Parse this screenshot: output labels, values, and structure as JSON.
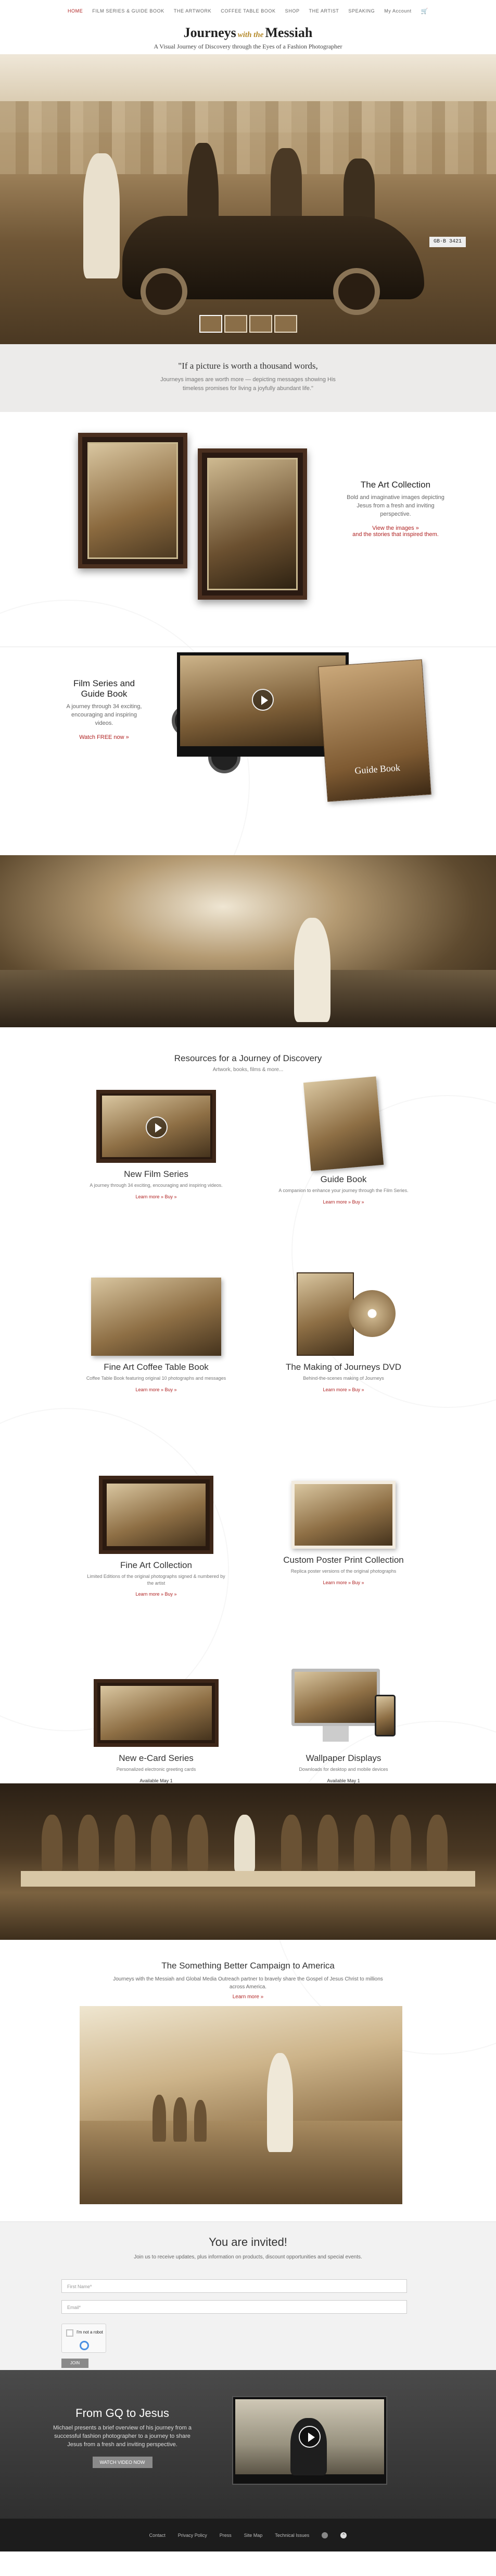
{
  "nav": {
    "items": [
      "HOME",
      "FILM SERIES & GUIDE BOOK",
      "THE ARTWORK",
      "COFFEE TABLE BOOK",
      "SHOP",
      "THE ARTIST",
      "SPEAKING",
      "My Account"
    ],
    "active_index": 0
  },
  "logo": {
    "title_left": "Journeys",
    "title_mid": "with the",
    "title_right": "Messiah",
    "subtitle": "A Visual Journey of Discovery through the Eyes of a Fashion Photographer"
  },
  "hero": {
    "plate": "GB·B 3421",
    "slide_count": 4,
    "active_slide": 1
  },
  "quote": {
    "main": "\"If a picture is worth a thousand words,",
    "text": "Journeys images are worth more — depicting messages showing His timeless promises for living a joyfully abundant life.\""
  },
  "art_collection": {
    "title": "The Art Collection",
    "body": "Bold and imaginative images depicting Jesus from a fresh and inviting perspective.",
    "link": "View the images »\nand the stories that inspired them."
  },
  "film_series": {
    "title": "Film Series and Guide Book",
    "body": "A journey through 34 exciting, encouraging and inspiring videos.",
    "link": "Watch FREE now »",
    "book_label": "Guide Book"
  },
  "resources": {
    "title": "Resources for a Journey of Discovery",
    "subtitle": "Artwork, books, films & more...",
    "tiles": [
      {
        "title": "New Film Series",
        "desc": "A journey through 34 exciting, encouraging and inspiring videos.",
        "link": "Learn more » Buy »"
      },
      {
        "title": "Guide Book",
        "desc": "A companion to enhance your journey through the Film Series.",
        "link": "Learn more » Buy »"
      },
      {
        "title": "Fine Art Coffee Table Book",
        "desc": "Coffee Table Book featuring original 10 photographs and messages",
        "link": "Learn more » Buy »"
      },
      {
        "title": "The Making of Journeys DVD",
        "desc": "Behind-the-scenes making of Journeys",
        "link": "Learn more » Buy »"
      },
      {
        "title": "Fine Art Collection",
        "desc": "Limited Editions of the original photographs signed & numbered by the artist",
        "link": "Learn more » Buy »"
      },
      {
        "title": "Custom Poster Print Collection",
        "desc": "Replica poster versions of the original photographs",
        "link": "Learn more » Buy »"
      },
      {
        "title": "New e-Card Series",
        "desc": "Personalized electronic greeting cards",
        "link": "Available May 1"
      },
      {
        "title": "Wallpaper Displays",
        "desc": "Downloads for desktop and mobile devices",
        "link": "Available May 1"
      }
    ]
  },
  "campaign": {
    "title": "The Something Better Campaign to America",
    "body": "Journeys with the Messiah and Global Media Outreach partner to bravely share the Gospel of Jesus Christ to millions across America.",
    "link": "Learn more »"
  },
  "invite": {
    "title": "You are invited!",
    "body": "Join us to receive updates, plus information on products, discount opportunities and special events.",
    "name_placeholder": "First Name*",
    "email_placeholder": "Email*",
    "captcha_label": "I'm not a robot",
    "submit": "JOIN"
  },
  "gq": {
    "title": "From GQ to Jesus",
    "body": "Michael presents a brief overview of his journey from a successful fashion photographer to a journey to share Jesus from a fresh and inviting perspective.",
    "button": "WATCH VIDEO NOW"
  },
  "footer": {
    "links": [
      "Contact",
      "Privacy Policy",
      "Press",
      "Site Map",
      "Technical Issues"
    ],
    "to_top": "^"
  },
  "colors": {
    "accent": "#b02323",
    "sepia": "#8b6a3f",
    "footer": "#1c1c1c"
  }
}
